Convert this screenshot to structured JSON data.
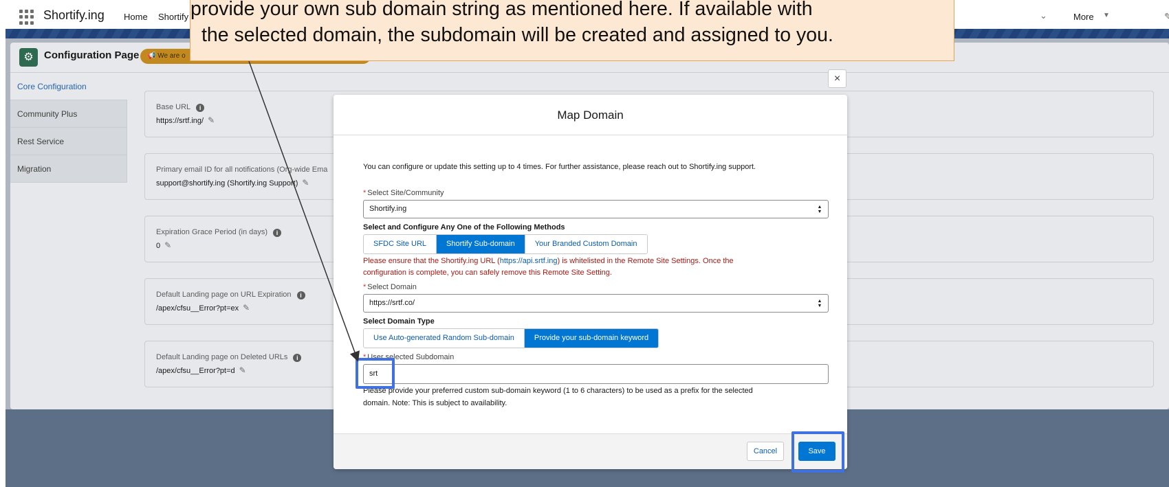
{
  "header": {
    "app_name": "Shortify.ing",
    "nav_home": "Home",
    "nav_app": "Shortify",
    "nav_more": "More"
  },
  "page": {
    "title": "Configuration Page",
    "badge": "We are o",
    "tabs": [
      "Core Configuration",
      "Community Plus",
      "Rest Service",
      "Migration"
    ],
    "settings": [
      {
        "label": "Base URL",
        "value": "https://srtf.ing/"
      },
      {
        "label": "Primary email ID for all notifications (Org-wide Ema",
        "value": "support@shortify.ing (Shortify.ing Support)"
      },
      {
        "label": "Expiration Grace Period (in days)",
        "value": "0"
      },
      {
        "label": "Default Landing page on URL Expiration",
        "value": "/apex/cfsu__Error?pt=ex"
      },
      {
        "label": "Default Landing page on Deleted URLs",
        "value": "/apex/cfsu__Error?pt=d"
      }
    ]
  },
  "modal": {
    "title": "Map Domain",
    "close_symbol": "×",
    "intro": "You can configure or update this setting up to 4 times. For further assistance, please reach out to Shortify.ing support.",
    "site_label": "Select Site/Community",
    "site_value": "Shortify.ing",
    "methods_label": "Select and Configure Any One of the Following Methods",
    "methods": [
      "SFDC Site URL",
      "Shortify Sub-domain",
      "Your Branded Custom Domain"
    ],
    "methods_selected": 1,
    "warning_1a": "Please ensure that the Shortify.ing URL (",
    "warning_link": "https://api.srtf.ing",
    "warning_1b": ") is whitelisted in the Remote Site Settings. Once the",
    "warning_2": "configuration is complete, you can safely remove this Remote Site Setting.",
    "domain_label": "Select Domain",
    "domain_value": "https://srtf.co/",
    "domain_type_label": "Select Domain Type",
    "domain_types": [
      "Use Auto-generated Random Sub-domain",
      "Provide your sub-domain keyword"
    ],
    "domain_types_selected": 1,
    "subdomain_label": "User selected Subdomain",
    "subdomain_value": "srt",
    "help_1": "Please provide your preferred custom sub-domain keyword (1 to 6 characters) to be used as a prefix for the selected",
    "help_2": "domain. Note: This is subject to availability.",
    "cancel_label": "Cancel",
    "save_label": "Save"
  },
  "callout": {
    "line_1": "provide your own sub domain string as mentioned here. If available with",
    "line_2": "the selected domain, the subdomain will be created and assigned to you."
  },
  "colors": {
    "brand_blue": "#0176d3",
    "highlight": "#3f72e0",
    "warning": "#a61a14",
    "callout_bg": "#fde9d3"
  }
}
